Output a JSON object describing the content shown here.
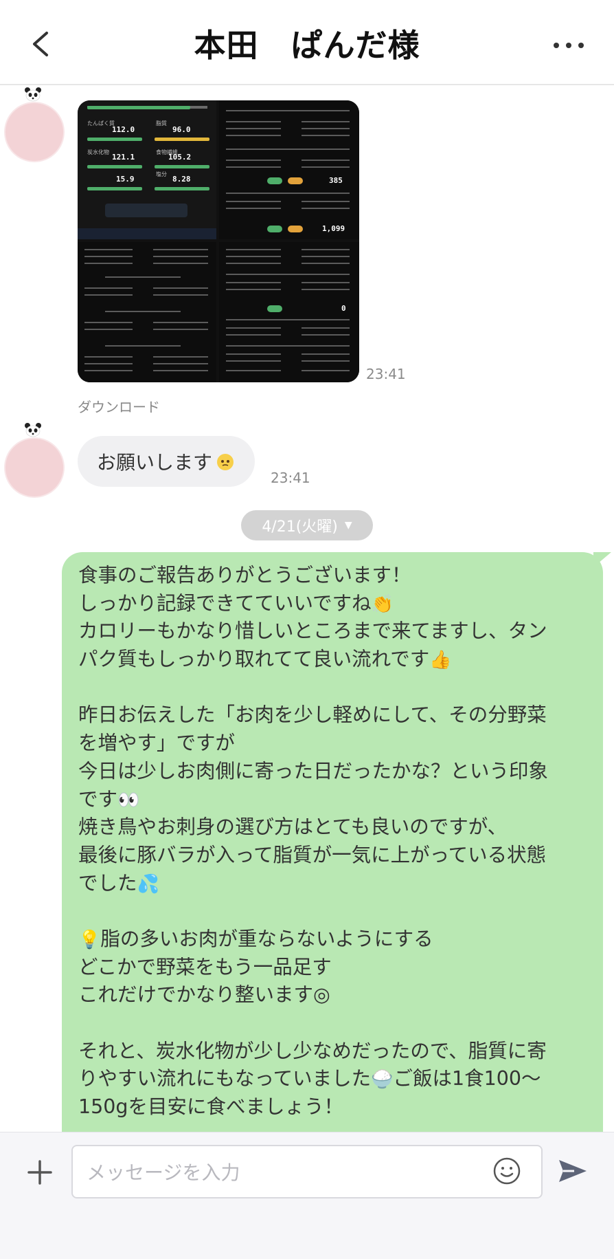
{
  "header": {
    "title": "本田　ぱんだ様",
    "back_icon": "chevron-left-icon",
    "more_icon": "ellipsis-icon"
  },
  "messages": {
    "image": {
      "time": "23:41",
      "download_label": "ダウンロード"
    },
    "left_text": {
      "text": "お願いします",
      "time": "23:41"
    },
    "date_separator": "4/21(火曜)",
    "right": {
      "lines": [
        "食事のご報告ありがとうございます！",
        "しっかり記録できてていいですね",
        "カロリーもかなり惜しいところまで来てますし、タン",
        "パク質もしっかり取れてて良い流れです",
        "",
        "昨日お伝えした「お肉を少し軽めにして、その分野菜",
        "を増やす」ですが",
        "今日は少しお肉側に寄った日だったかな？という印象",
        "です",
        "焼き鳥やお刺身の選び方はとても良いのですが、",
        "最後に豚バラが入って脂質が一気に上がっている状態",
        "でした",
        "",
        "脂の多いお肉が重ならないようにする",
        "どこかで野菜をもう一品足す",
        "これだけでかなり整います◎",
        "",
        "それと、炭水化物が少し少なめだったので、脂質に寄",
        "りやすい流れにもなっていました",
        "150gを目安に食べましょう！"
      ],
      "line19_suffix": "ご飯は1食100〜"
    }
  },
  "screenshot": {
    "values": [
      "112.0",
      "96.0",
      "121.1",
      "105.2",
      "15.9",
      "8.28",
      "385",
      "1,099",
      "0"
    ],
    "labels": [
      "たんぱく質",
      "脂質",
      "炭水化物",
      "食物繊維",
      "塩分"
    ],
    "units": "kcal"
  },
  "input": {
    "placeholder": "メッセージを入力"
  },
  "colors": {
    "bubble_right": "#b9e8b3",
    "bubble_left": "#f0f0f2",
    "avatar": "#f3d3d6",
    "date_pill": "#d3d3d3"
  }
}
